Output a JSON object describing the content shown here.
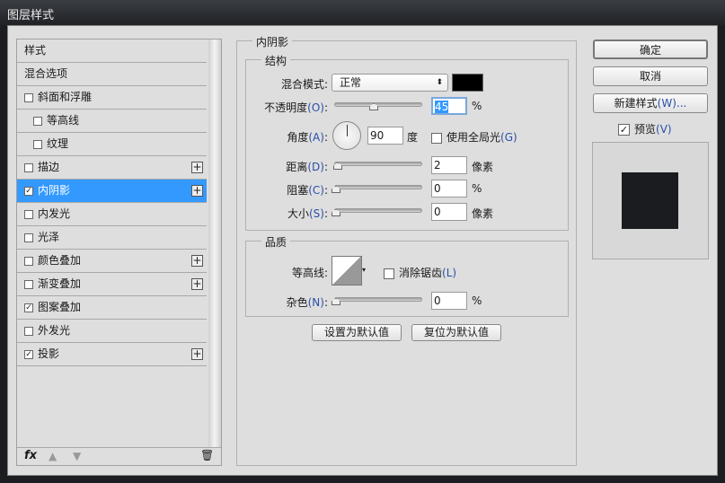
{
  "window": {
    "title": "图层样式"
  },
  "sidebar": {
    "items": [
      {
        "label": "样式",
        "checkbox": false,
        "checked": false,
        "plus": false,
        "indent": 0
      },
      {
        "label": "混合选项",
        "checkbox": false,
        "checked": false,
        "plus": false,
        "indent": 0
      },
      {
        "label": "斜面和浮雕",
        "checkbox": true,
        "checked": false,
        "plus": false,
        "indent": 0
      },
      {
        "label": "等高线",
        "checkbox": true,
        "checked": false,
        "plus": false,
        "indent": 1
      },
      {
        "label": "纹理",
        "checkbox": true,
        "checked": false,
        "plus": false,
        "indent": 1
      },
      {
        "label": "描边",
        "checkbox": true,
        "checked": false,
        "plus": true,
        "indent": 0
      },
      {
        "label": "内阴影",
        "checkbox": true,
        "checked": true,
        "plus": true,
        "indent": 0,
        "selected": true
      },
      {
        "label": "内发光",
        "checkbox": true,
        "checked": false,
        "plus": false,
        "indent": 0
      },
      {
        "label": "光泽",
        "checkbox": true,
        "checked": false,
        "plus": false,
        "indent": 0
      },
      {
        "label": "颜色叠加",
        "checkbox": true,
        "checked": false,
        "plus": true,
        "indent": 0
      },
      {
        "label": "渐变叠加",
        "checkbox": true,
        "checked": false,
        "plus": true,
        "indent": 0
      },
      {
        "label": "图案叠加",
        "checkbox": true,
        "checked": true,
        "plus": false,
        "indent": 0
      },
      {
        "label": "外发光",
        "checkbox": true,
        "checked": false,
        "plus": false,
        "indent": 0
      },
      {
        "label": "投影",
        "checkbox": true,
        "checked": true,
        "plus": true,
        "indent": 0
      }
    ],
    "toolbar": {
      "fx": "fx"
    }
  },
  "main": {
    "title": "内阴影",
    "structure": {
      "title": "结构",
      "blend_mode": {
        "label": "混合模式",
        "colon": ":",
        "value": "正常",
        "color": "#000000"
      },
      "opacity": {
        "label": "不透明度",
        "key": "(O)",
        "value": "45",
        "unit": "%",
        "pct": 45
      },
      "angle": {
        "label": "角度",
        "key": "(A)",
        "value": "90",
        "unit": "度",
        "global_label": "使用全局光",
        "global_key": "(G)",
        "global_checked": false
      },
      "distance": {
        "label": "距离",
        "key": "(D)",
        "value": "2",
        "unit": "像素"
      },
      "choke": {
        "label": "阻塞",
        "key": "(C)",
        "value": "0",
        "unit": "%"
      },
      "size": {
        "label": "大小",
        "key": "(S)",
        "value": "0",
        "unit": "像素"
      }
    },
    "quality": {
      "title": "品质",
      "contour": {
        "label": "等高线",
        "antialias_label": "消除锯齿",
        "antialias_key": "(L)",
        "antialias_checked": false
      },
      "noise": {
        "label": "杂色",
        "key": "(N)",
        "value": "0",
        "unit": "%"
      }
    },
    "make_default": "设置为默认值",
    "reset_default": "复位为默认值"
  },
  "right": {
    "ok": "确定",
    "cancel": "取消",
    "new_style": "新建样式",
    "new_style_key": "(W)...",
    "preview_label": "预览",
    "preview_key": "(V)",
    "preview_checked": true,
    "preview_color": "#1a1c20"
  }
}
